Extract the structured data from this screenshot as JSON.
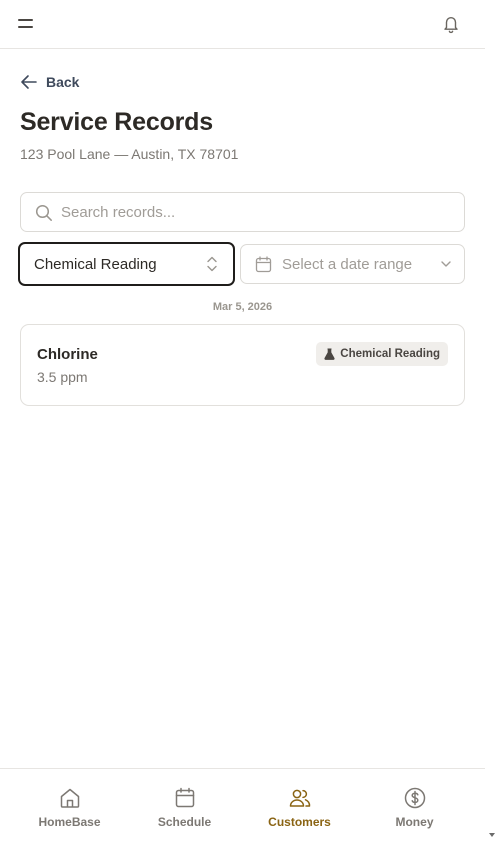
{
  "topbar": {
    "menu_icon": "menu-icon",
    "bell_icon": "bell-icon"
  },
  "back": {
    "label": "Back",
    "icon": "arrow-left-icon"
  },
  "page": {
    "title": "Service Records",
    "subtitle": "123 Pool Lane — Austin, TX 78701"
  },
  "search": {
    "placeholder": "Search records...",
    "value": "",
    "icon": "search-icon"
  },
  "filters": {
    "type_value": "Chemical Reading",
    "type_icon": "chevron-up-down-icon",
    "date_placeholder": "Select a date range",
    "date_icon": "calendar-icon",
    "date_chevron": "chevron-down-icon"
  },
  "records": {
    "date_header": "Mar 5, 2026",
    "items": [
      {
        "name": "Chlorine",
        "value": "3.5 ppm",
        "badge": "Chemical Reading",
        "badge_icon": "flask-icon"
      }
    ]
  },
  "nav": {
    "items": [
      {
        "label": "HomeBase",
        "icon": "home-icon",
        "active": false
      },
      {
        "label": "Schedule",
        "icon": "calendar-icon",
        "active": false
      },
      {
        "label": "Customers",
        "icon": "users-icon",
        "active": true
      },
      {
        "label": "Money",
        "icon": "dollar-circle-icon",
        "active": false
      }
    ]
  },
  "colors": {
    "accent": "#8a6414",
    "text": "#2d2a26",
    "muted": "#7c7873",
    "border": "#dcdad6"
  }
}
